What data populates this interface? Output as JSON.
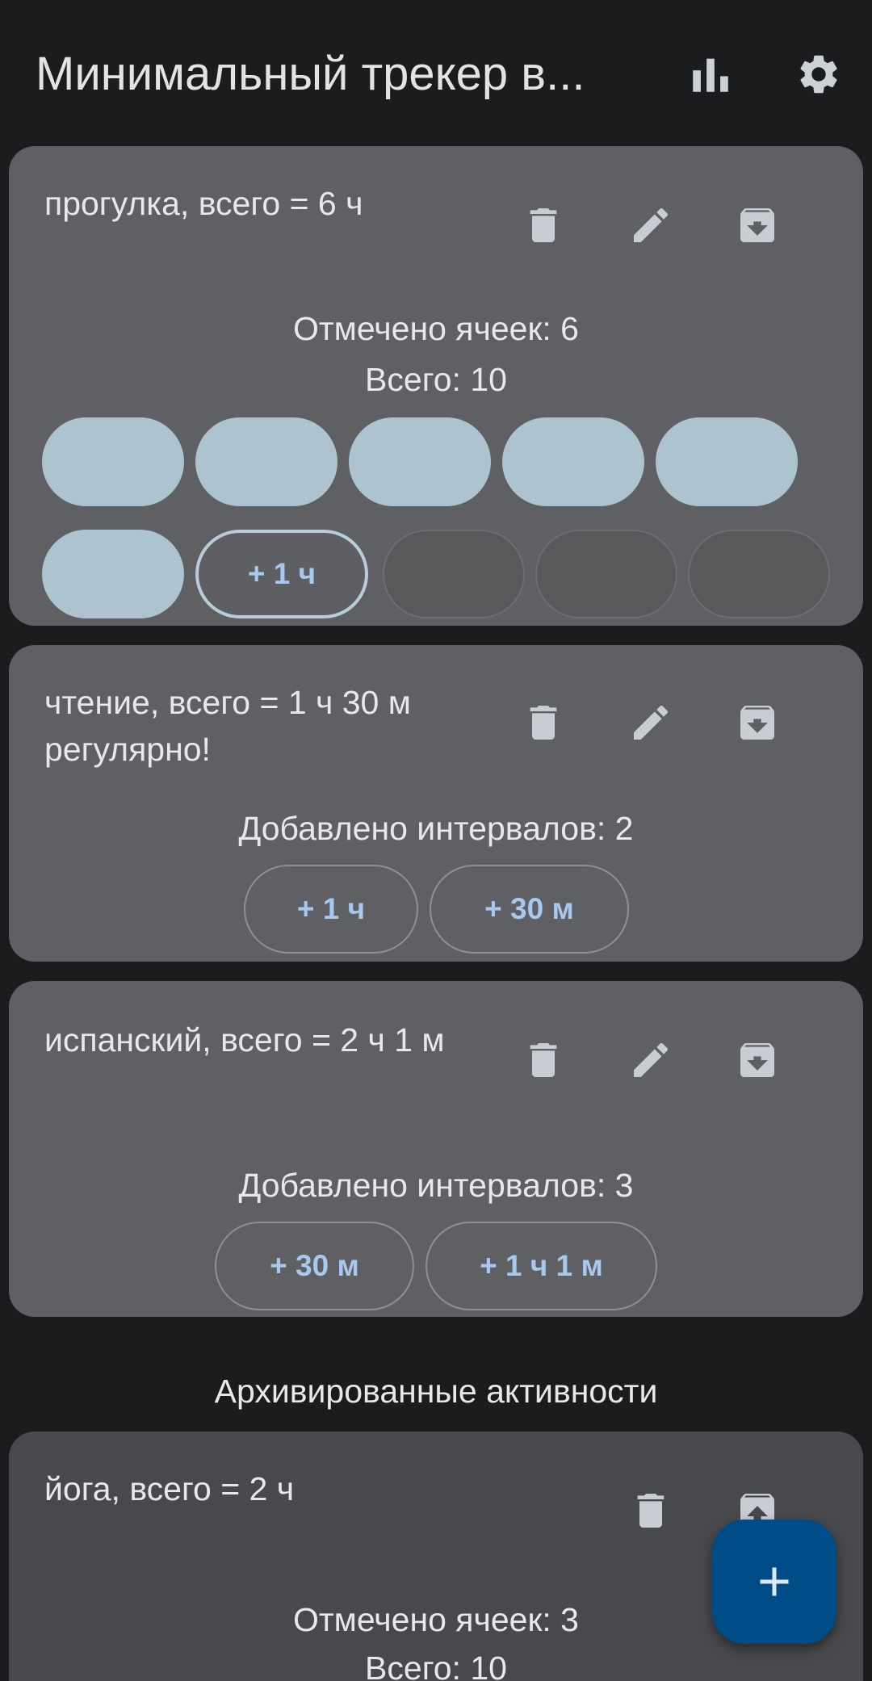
{
  "app": {
    "title": "Минимальный трекер в...",
    "icons": {
      "stats": "bar-chart-icon",
      "settings": "gear-icon"
    }
  },
  "cards": [
    {
      "title": "прогулка, всего = 6 ч",
      "stat_1": "Отмечено ячеек: 6",
      "stat_2": "Всего: 10",
      "cells_filled": 6,
      "cells_total": 10,
      "current_cell_label": "+ 1 ч"
    },
    {
      "title": "чтение, всего = 1 ч 30 м регулярно!",
      "stat_1": "Добавлено интервалов: 2",
      "intervals": [
        "+ 1 ч",
        "+ 30 м"
      ]
    },
    {
      "title": "испанский, всего = 2 ч 1 м",
      "stat_1": "Добавлено интервалов: 3",
      "intervals": [
        "+ 30 м",
        "+ 1 ч 1 м"
      ]
    }
  ],
  "archived_section": {
    "title": "Архивированные активности",
    "cards": [
      {
        "title": "йога, всего = 2 ч",
        "stat_1": "Отмечено ячеек: 3",
        "stat_2": "Всего: 10"
      }
    ]
  },
  "icons": {
    "delete": "trash-icon",
    "edit": "pencil-icon",
    "archive": "archive-icon",
    "unarchive": "unarchive-icon",
    "add": "plus-icon"
  },
  "colors": {
    "background": "#1b1c1e",
    "card": "#5f6064",
    "archived_card": "#48494c",
    "filled_cell": "#aec3d0",
    "accent_text": "#a7c8ef",
    "fab": "#004c86"
  }
}
